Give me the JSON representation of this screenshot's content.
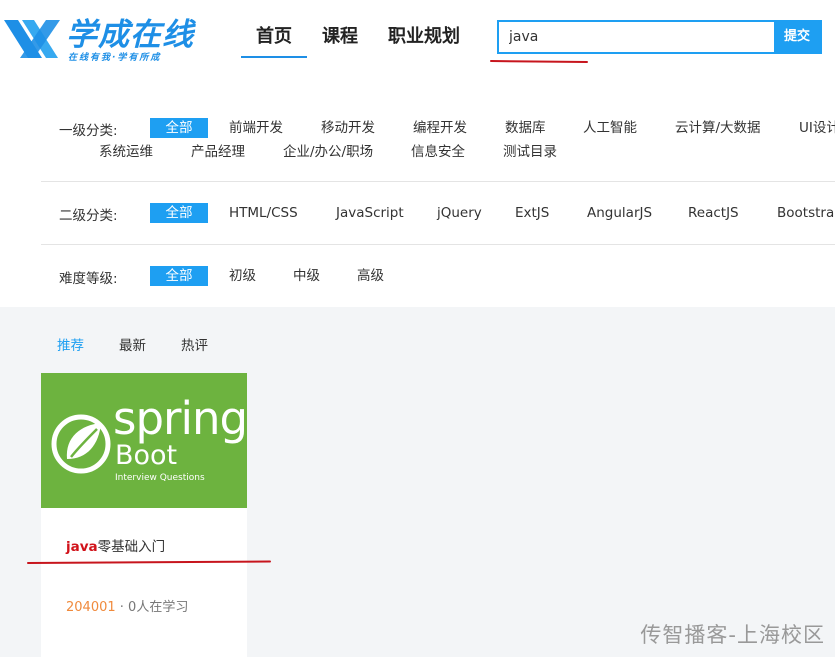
{
  "logo": {
    "text": "学成在线",
    "slogan": "在线有我·学有所成"
  },
  "nav": [
    "首页",
    "课程",
    "职业规划"
  ],
  "search": {
    "value": "java",
    "button": "提交"
  },
  "filters": {
    "level1": {
      "label": "一级分类:",
      "items": [
        "全部",
        "前端开发",
        "移动开发",
        "编程开发",
        "数据库",
        "人工智能",
        "云计算/大数据",
        "UI设计",
        "系统运维",
        "产品经理",
        "企业/办公/职场",
        "信息安全",
        "测试目录"
      ]
    },
    "level2": {
      "label": "二级分类:",
      "items": [
        "全部",
        "HTML/CSS",
        "JavaScript",
        "jQuery",
        "ExtJS",
        "AngularJS",
        "ReactJS",
        "Bootstrap"
      ]
    },
    "difficulty": {
      "label": "难度等级:",
      "items": [
        "全部",
        "初级",
        "中级",
        "高级"
      ]
    }
  },
  "sort": [
    "推荐",
    "最新",
    "热评"
  ],
  "course": {
    "image": {
      "line1": "spring",
      "line2": "Boot",
      "line3": "Interview Questions"
    },
    "title_highlight": "java",
    "title_rest": "零基础入门",
    "id": "204001",
    "students": "· 0人在学习"
  },
  "watermark": "传智播客-上海校区",
  "colors": {
    "accent": "#1e9ff2",
    "brand": "#1e8fe6",
    "highlight": "#d1121a",
    "spring_green": "#6db33f"
  }
}
